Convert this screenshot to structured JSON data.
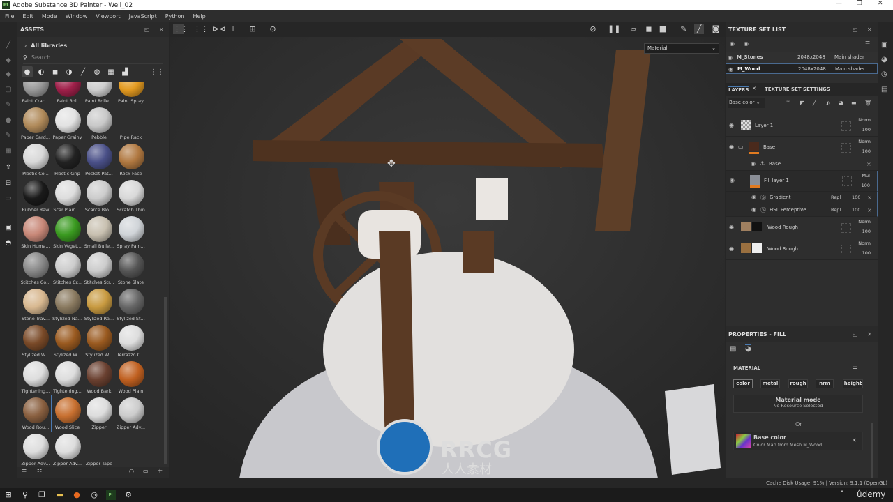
{
  "window": {
    "title": "Adobe Substance 3D Painter - Well_02",
    "app_icon": "Pt"
  },
  "menu": [
    "File",
    "Edit",
    "Mode",
    "Window",
    "Viewport",
    "JavaScript",
    "Python",
    "Help"
  ],
  "assets": {
    "title": "ASSETS",
    "library": "All libraries",
    "search_placeholder": "Search",
    "filters": [
      "sphere-material-icon",
      "smart-material-icon",
      "mask-icon",
      "smart-mask-icon",
      "brush-icon",
      "particles-icon",
      "texture-icon",
      "environment-icon",
      "grid-view-icon"
    ],
    "items": [
      {
        "label": "Paint Crac...",
        "color": "#9a9a9a"
      },
      {
        "label": "Paint Roll",
        "color": "#a0204a"
      },
      {
        "label": "Paint Rolle...",
        "color": "#cfcfcf"
      },
      {
        "label": "Paint Spray",
        "color": "#e39a20"
      },
      {
        "label": "Paper Card...",
        "color": "#b08a5a"
      },
      {
        "label": "Paper Grainy",
        "color": "#e2e2e2"
      },
      {
        "label": "Pebble",
        "color": "#c8c8c8"
      },
      {
        "label": "Pipe Rack",
        "color": ""
      },
      {
        "label": "Plastic Co...",
        "color": "#d8d8d8"
      },
      {
        "label": "Plastic Grip",
        "color": "#222222"
      },
      {
        "label": "Pocket Pat...",
        "color": "#4a5088"
      },
      {
        "label": "Rock Face",
        "color": "#b07840"
      },
      {
        "label": "Rubber Raw",
        "color": "#1a1a1a"
      },
      {
        "label": "Scar Plain ...",
        "color": "#dddddd"
      },
      {
        "label": "Scarce Blo...",
        "color": "#cccccc"
      },
      {
        "label": "Scratch Thin",
        "color": "#d8d8d8"
      },
      {
        "label": "Skin Huma...",
        "color": "#c88878"
      },
      {
        "label": "Skin Veget...",
        "color": "#3a9a20"
      },
      {
        "label": "Small Bulle...",
        "color": "#c8c0b0"
      },
      {
        "label": "Spray Pain...",
        "color": "#d0d4d8"
      },
      {
        "label": "Stitches Co...",
        "color": "#888888"
      },
      {
        "label": "Stitches Cr...",
        "color": "#cccccc"
      },
      {
        "label": "Stitches Str...",
        "color": "#cccccc"
      },
      {
        "label": "Stone Slate",
        "color": "#555555"
      },
      {
        "label": "Stone Trav...",
        "color": "#d8b890"
      },
      {
        "label": "Stylized Na...",
        "color": "#8a7a60"
      },
      {
        "label": "Stylized Ra...",
        "color": "#c89a40"
      },
      {
        "label": "Stylized St...",
        "color": "#666666"
      },
      {
        "label": "Stylized W...",
        "color": "#7a4a28"
      },
      {
        "label": "Stylized W...",
        "color": "#9a5a20"
      },
      {
        "label": "Stylized W...",
        "color": "#9a5a20"
      },
      {
        "label": "Terrazzo C...",
        "color": "#dddddd"
      },
      {
        "label": "Tightening...",
        "color": "#dddddd"
      },
      {
        "label": "Tightening...",
        "color": "#dddddd"
      },
      {
        "label": "Wood Bark",
        "color": "#6a4030"
      },
      {
        "label": "Wood Plain",
        "color": "#c06020"
      },
      {
        "label": "Wood Rou...",
        "color": "#8a6040",
        "selected": true
      },
      {
        "label": "Wood Slice",
        "color": "#c87030"
      },
      {
        "label": "Zipper",
        "color": "#dddddd"
      },
      {
        "label": "Zipper Adv...",
        "color": "#cccccc"
      },
      {
        "label": "Zipper Adv...",
        "color": "#dddddd"
      },
      {
        "label": "Zipper Adv...",
        "color": "#dddddd"
      },
      {
        "label": "Zipper Tape",
        "color": ""
      }
    ]
  },
  "viewport": {
    "display_mode": "Material"
  },
  "texture_set_list": {
    "title": "TEXTURE SET LIST",
    "sets": [
      {
        "name": "M_Stones",
        "resolution": "2048x2048",
        "shader": "Main shader"
      },
      {
        "name": "M_Wood",
        "resolution": "2048x2048",
        "shader": "Main shader",
        "selected": true
      }
    ]
  },
  "layers": {
    "tab_layers": "LAYERS",
    "tab_settings": "TEXTURE SET SETTINGS",
    "channel": "Base color",
    "items": [
      {
        "name": "Layer 1",
        "blend": "Norm",
        "opacity": "100"
      },
      {
        "name": "Base",
        "blend": "Norm",
        "opacity": "100",
        "type": "folder"
      },
      {
        "name": "Base",
        "type": "anchor"
      },
      {
        "name": "Fill layer 1",
        "blend": "Mul",
        "opacity": "100",
        "selected": true
      },
      {
        "name": "Gradient",
        "blend": "Repl",
        "opacity": "100",
        "type": "filter"
      },
      {
        "name": "HSL Perceptive",
        "blend": "Repl",
        "opacity": "100",
        "type": "filter"
      },
      {
        "name": "Wood Rough",
        "blend": "Norm",
        "opacity": "100"
      },
      {
        "name": "Wood Rough",
        "blend": "Norm",
        "opacity": "100"
      }
    ]
  },
  "properties": {
    "title": "PROPERTIES - FILL",
    "section": "MATERIAL",
    "channels": [
      "color",
      "metal",
      "rough",
      "nrm",
      "height"
    ],
    "material_mode": "Material mode",
    "no_resource": "No Resource Selected",
    "or": "Or",
    "base_color_title": "Base color",
    "base_color_desc": "Color Map from Mesh M_Wood"
  },
  "status": {
    "cache": "Cache Disk Usage:   91% | Version: 9.1.1 (OpenGL)"
  },
  "watermark": {
    "text": "RRCG",
    "sub": "人人素材",
    "udemy": "ûdemy"
  }
}
